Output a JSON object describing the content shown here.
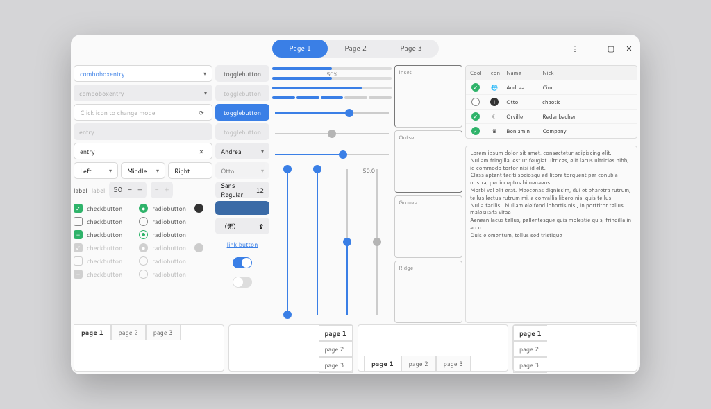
{
  "header": {
    "pages": [
      "Page 1",
      "Page 2",
      "Page 3"
    ],
    "active_page": 0
  },
  "col1": {
    "comboboxentry_selected": "comboboxentry",
    "comboboxentry_placeholder": "comboboxentry",
    "iconentry_placeholder": "Click icon to change mode",
    "entry_placeholder": "entry",
    "entry_value": "entry",
    "split_buttons": [
      "Left",
      "Middle",
      "Right"
    ],
    "label_text": "label",
    "label_dim": "label",
    "spin_value": "50",
    "checkbuttons": [
      "checkbutton",
      "checkbutton",
      "checkbutton",
      "checkbutton",
      "checkbutton",
      "checkbutton"
    ],
    "radiobuttons": [
      "radiobutton",
      "radiobutton",
      "radiobutton",
      "radiobutton",
      "radiobutton",
      "radiobutton"
    ]
  },
  "col2": {
    "toggle_labels": [
      "togglebutton",
      "togglebutton",
      "togglebutton",
      "togglebutton"
    ],
    "combo_andrea": "Andrea",
    "combo_otto": "Otto",
    "font_name": "Sans Regular",
    "font_size": "12",
    "file_none": "（无）",
    "link_label": "link button"
  },
  "col3": {
    "progress_label": "50%",
    "progress_values": [
      50,
      50,
      75
    ],
    "level_value": 3,
    "level_max": 5,
    "hscale1": 65,
    "hscale2": 50,
    "hscale3": 60,
    "vscale_label": "50.0",
    "vscales": [
      {
        "value": 100,
        "min": true,
        "max": true
      },
      {
        "value": 100
      },
      {
        "value": 50
      },
      {
        "value": 50,
        "grey": true
      }
    ]
  },
  "col4": {
    "frames": [
      "Inset",
      "Outset",
      "Groove",
      "Ridge"
    ]
  },
  "table": {
    "columns": [
      "Cool",
      "Icon",
      "Name",
      "Nick"
    ],
    "rows": [
      {
        "cool": true,
        "icon": "globe-icon",
        "name": "Andrea",
        "nick": "Cimi"
      },
      {
        "cool": false,
        "icon": "alert-icon",
        "name": "Otto",
        "nick": "chaotic"
      },
      {
        "cool": true,
        "icon": "moon-icon",
        "name": "Orville",
        "nick": "Redenbacher"
      },
      {
        "cool": true,
        "icon": "crown-icon",
        "name": "Benjamin",
        "nick": "Company"
      }
    ]
  },
  "textview": {
    "p1": "Lorem ipsum dolor sit amet, consectetur adipiscing elit.",
    "p2": "Nullam fringilla, est ut feugiat ultrices, elit lacus ultricies nibh, id commodo tortor nisi id elit.",
    "p3": "Class aptent taciti sociosqu ad litora torquent per conubia nostra, per inceptos himenaeos.",
    "p4": "Morbi vel elit erat. Maecenas dignissim, dui et pharetra rutrum, tellus lectus rutrum mi, a convallis libero nisi quis tellus.",
    "p5": "Nulla facilisi. Nullam eleifend lobortis nisl, in porttitor tellus malesuada vitae.",
    "p6": "Aenean lacus tellus, pellentesque quis molestie quis, fringilla in arcu.",
    "p7": "Duis elementum, tellus sed tristique"
  },
  "notebooks": {
    "top_tabs": [
      "page 1",
      "page 2",
      "page 3"
    ],
    "right_tabs": [
      "page 1",
      "page 2",
      "page 3"
    ],
    "bottom_tabs": [
      "page 1",
      "page 2",
      "page 3"
    ],
    "left_tabs": [
      "page 1",
      "page 2",
      "page 3"
    ]
  }
}
